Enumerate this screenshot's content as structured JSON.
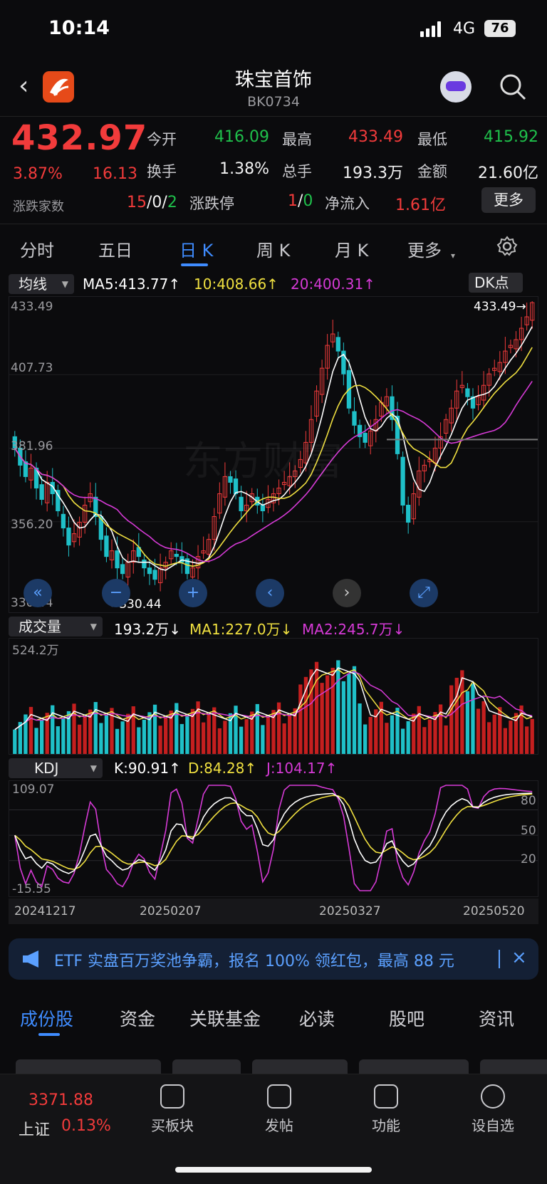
{
  "status_bar": {
    "time": "10:14",
    "network": "4G",
    "battery": "76"
  },
  "header": {
    "title": "珠宝首饰",
    "code": "BK0734"
  },
  "quote": {
    "price": "432.97",
    "change_pct": "3.87%",
    "change": "16.13",
    "open_label": "今开",
    "open": "416.09",
    "high_label": "最高",
    "high": "433.49",
    "low_label": "最低",
    "low": "415.92",
    "turnover_label": "换手",
    "turnover": "1.38%",
    "volume_label": "总手",
    "volume": "193.3万",
    "amount_label": "金额",
    "amount": "21.60亿",
    "breadth_label": "涨跌家数",
    "breadth_up": "15",
    "breadth_sep1": "/",
    "breadth_flat": "0",
    "breadth_sep2": "/",
    "breadth_down": "2",
    "limit_label": "涨跌停",
    "limit_up": "1",
    "limit_sep": "/",
    "limit_down": "0",
    "netflow_label": "净流入",
    "netflow": "1.61亿",
    "more_button": "更多"
  },
  "period_tabs": [
    "分时",
    "五日",
    "日 K",
    "周 K",
    "月 K",
    "更多"
  ],
  "active_period": "日 K",
  "ma_bar": {
    "selector": "均线",
    "ma5": "MA5:413.77↑",
    "ma10": "10:408.66↑",
    "ma20": "20:400.31↑",
    "dk_button": "DK点"
  },
  "vol_bar": {
    "selector": "成交量",
    "vol": "193.2万↓",
    "ma1": "MA1:227.0万↓",
    "ma2": "MA2:245.7万↓"
  },
  "kdj_bar": {
    "selector": "KDJ",
    "k": "K:90.91↑",
    "d": "D:84.28↑",
    "j": "J:104.17↑"
  },
  "chart_labels": {
    "price_axis": [
      "433.49",
      "407.73",
      "381.96",
      "356.20",
      "330.44"
    ],
    "high_marker": "433.49→",
    "low_marker": "←330.44",
    "vol_axis_top": "524.2万",
    "kdj_axis": [
      "109.07",
      "-15.55"
    ],
    "kdj_right": [
      "80",
      "50",
      "20"
    ],
    "dates": [
      "20241217",
      "20250207",
      "20250327",
      "20250520"
    ],
    "watermark": "东方财富"
  },
  "colors": {
    "up": "#f23b3b",
    "down": "#1fc0c8",
    "ma5": "#ffffff",
    "ma10": "#f0e040",
    "ma20": "#d63ad6",
    "accent": "#3f8cff"
  },
  "chart_data": [
    {
      "type": "candlestick",
      "title": "日 K",
      "ylim": [
        330.44,
        433.49
      ],
      "x_labels": [
        "20241217",
        "20250207",
        "20250327",
        "20250520"
      ],
      "closes": [
        382,
        376,
        372,
        375,
        368,
        364,
        370,
        366,
        360,
        354,
        348,
        352,
        356,
        362,
        366,
        358,
        350,
        344,
        346,
        340,
        338,
        342,
        346,
        344,
        340,
        338,
        336,
        340,
        342,
        346,
        344,
        342,
        338,
        340,
        344,
        346,
        350,
        358,
        366,
        372,
        370,
        366,
        360,
        362,
        366,
        362,
        360,
        364,
        366,
        368,
        370,
        372,
        374,
        378,
        384,
        392,
        402,
        410,
        418,
        422,
        416,
        408,
        396,
        390,
        386,
        384,
        388,
        392,
        398,
        400,
        392,
        380,
        362,
        356,
        366,
        374,
        376,
        378,
        382,
        386,
        392,
        396,
        402,
        404,
        400,
        396,
        400,
        404,
        408,
        410,
        412,
        416,
        418,
        420,
        424,
        428,
        432.97
      ],
      "series": [
        {
          "name": "MA5",
          "last": "413.77"
        },
        {
          "name": "10",
          "last": "408.66"
        },
        {
          "name": "20",
          "last": "400.31"
        }
      ],
      "high": 433.49,
      "low": 330.44
    },
    {
      "type": "bar",
      "title": "成交量",
      "ylim": [
        0,
        524.2
      ],
      "series": [
        {
          "name": "MA1",
          "last": "227.0万"
        },
        {
          "name": "MA2",
          "last": "245.7万"
        }
      ],
      "last_value": "193.2万"
    },
    {
      "type": "line",
      "title": "KDJ",
      "ylim": [
        -15.55,
        109.07
      ],
      "series": [
        {
          "name": "K",
          "last": 90.91
        },
        {
          "name": "D",
          "last": 84.28
        },
        {
          "name": "J",
          "last": 104.17
        }
      ]
    }
  ],
  "banner": {
    "text": "ETF 实盘百万奖池争霸，报名 100% 领红包，最高 88 元"
  },
  "bottom_tabs": [
    "成份股",
    "资金",
    "关联基金",
    "必读",
    "股吧",
    "资讯"
  ],
  "bottom_nav": {
    "index_value": "3371.88",
    "index_name": "上证",
    "index_change": "0.13%",
    "items": [
      "买板块",
      "发帖",
      "功能",
      "设自选"
    ]
  }
}
